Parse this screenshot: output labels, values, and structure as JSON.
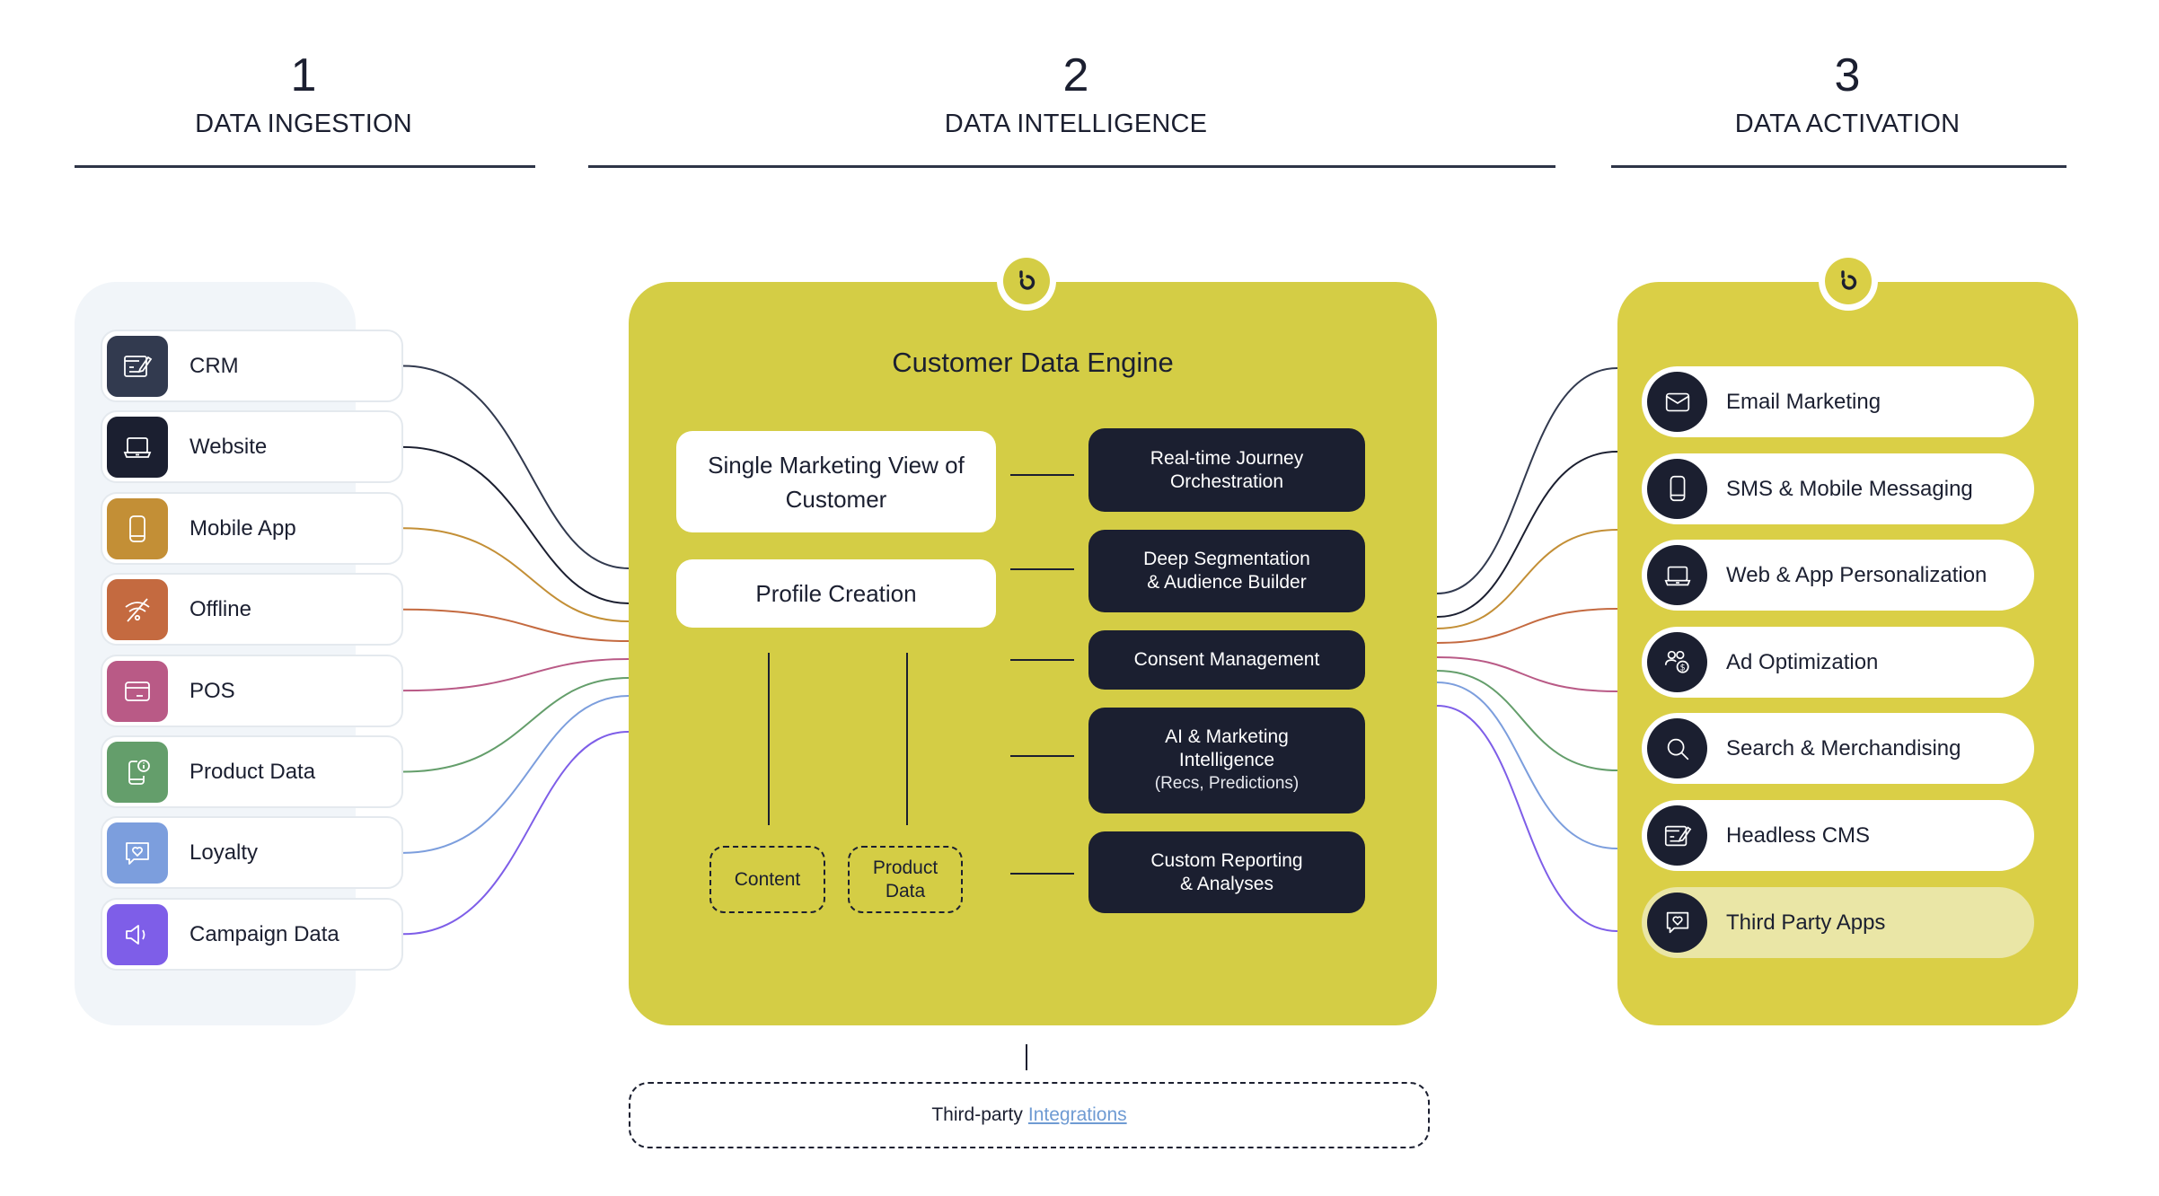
{
  "columns": [
    {
      "number": "1",
      "label": "DATA INGESTION"
    },
    {
      "number": "2",
      "label": "DATA INTELLIGENCE"
    },
    {
      "number": "3",
      "label": "DATA ACTIVATION"
    }
  ],
  "sources": [
    {
      "label": "CRM",
      "icon": "crm-edit-icon",
      "color": "#323a4f"
    },
    {
      "label": "Website",
      "icon": "laptop-icon",
      "color": "#1b1f30"
    },
    {
      "label": "Mobile App",
      "icon": "mobile-icon",
      "color": "#c38f36"
    },
    {
      "label": "Offline",
      "icon": "wifi-off-icon",
      "color": "#c46a40"
    },
    {
      "label": "POS",
      "icon": "credit-card-icon",
      "color": "#b95a86"
    },
    {
      "label": "Product Data",
      "icon": "mobile-info-icon",
      "color": "#649e6b"
    },
    {
      "label": "Loyalty",
      "icon": "chat-heart-icon",
      "color": "#7c9edd"
    },
    {
      "label": "Campaign Data",
      "icon": "megaphone-icon",
      "color": "#7e5ee8"
    }
  ],
  "engine": {
    "title": "Customer Data Engine",
    "badge_icon": "brand-logo-icon",
    "core_boxes": [
      {
        "label": "Single Marketing View of Customer"
      },
      {
        "label": "Profile Creation"
      }
    ],
    "inputs": [
      {
        "label": "Content"
      },
      {
        "label": "Product Data"
      }
    ],
    "capabilities": [
      {
        "line1": "Real-time Journey",
        "line2": "Orchestration",
        "sub": ""
      },
      {
        "line1": "Deep Segmentation",
        "line2": "& Audience Builder",
        "sub": ""
      },
      {
        "line1": "Consent Management",
        "line2": "",
        "sub": ""
      },
      {
        "line1": "AI & Marketing",
        "line2": "Intelligence",
        "sub": "(Recs, Predictions)"
      },
      {
        "line1": "Custom Reporting",
        "line2": "& Analyses",
        "sub": ""
      }
    ]
  },
  "integrations": {
    "prefix": "Third-party",
    "link": "Integrations",
    "link_color": "#6f9bd3"
  },
  "destinations": [
    {
      "label": "Email Marketing",
      "icon": "envelope-icon"
    },
    {
      "label": "SMS & Mobile Messaging",
      "icon": "mobile-icon"
    },
    {
      "label": "Web & App Personalization",
      "icon": "laptop-icon"
    },
    {
      "label": "Ad Optimization",
      "icon": "users-dollar-icon"
    },
    {
      "label": "Search & Merchandising",
      "icon": "search-icon"
    },
    {
      "label": "Headless CMS",
      "icon": "cms-edit-icon"
    },
    {
      "label": "Third Party Apps",
      "icon": "chat-heart-icon",
      "muted": true
    }
  ],
  "colors": {
    "engine_yellow": "#d4cd45",
    "activation_yellow": "#dacf46",
    "dark": "#1b1f30",
    "ingestion_bg": "#f1f5f9"
  }
}
